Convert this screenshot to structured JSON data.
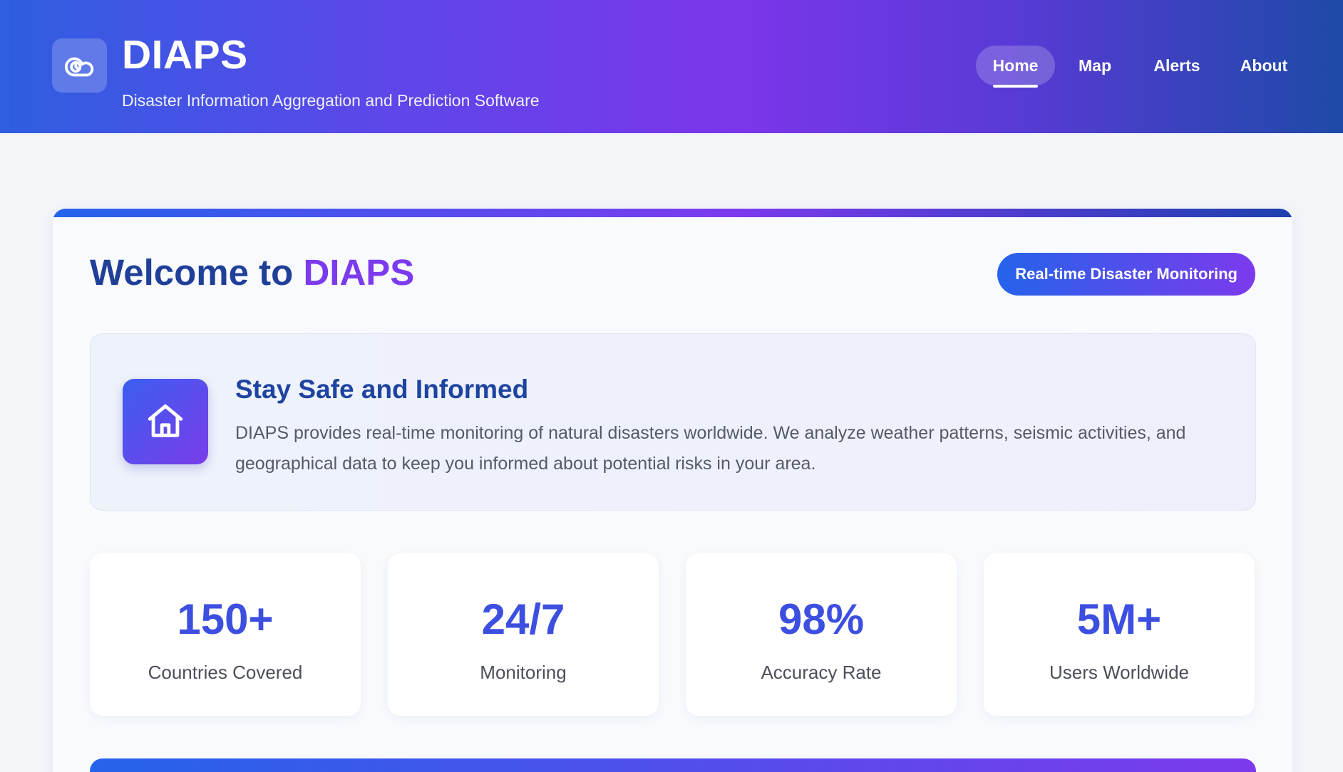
{
  "header": {
    "title": "DIAPS",
    "subtitle": "Disaster Information Aggregation and Prediction Software",
    "logo_icon": "cloud-clock-icon",
    "nav": [
      {
        "label": "Home",
        "active": true
      },
      {
        "label": "Map",
        "active": false
      },
      {
        "label": "Alerts",
        "active": false
      },
      {
        "label": "About",
        "active": false
      }
    ]
  },
  "main": {
    "welcome_prefix": "Welcome to",
    "welcome_brand": "DIAPS",
    "badge": "Real-time Disaster Monitoring",
    "info": {
      "icon": "home-icon",
      "title": "Stay Safe and Informed",
      "text": "DIAPS provides real-time monitoring of natural disasters worldwide. We analyze weather patterns, seismic activities, and geographical data to keep you informed about potential risks in your area."
    },
    "stats": [
      {
        "value": "150+",
        "label": "Countries Covered"
      },
      {
        "value": "24/7",
        "label": "Monitoring"
      },
      {
        "value": "98%",
        "label": "Accuracy Rate"
      },
      {
        "value": "5M+",
        "label": "Users Worldwide"
      }
    ]
  },
  "colors": {
    "brand_blue": "#2563eb",
    "brand_purple": "#7c3aed",
    "heading_blue": "#1f3f99",
    "stat_blue": "#3c4fe0"
  }
}
